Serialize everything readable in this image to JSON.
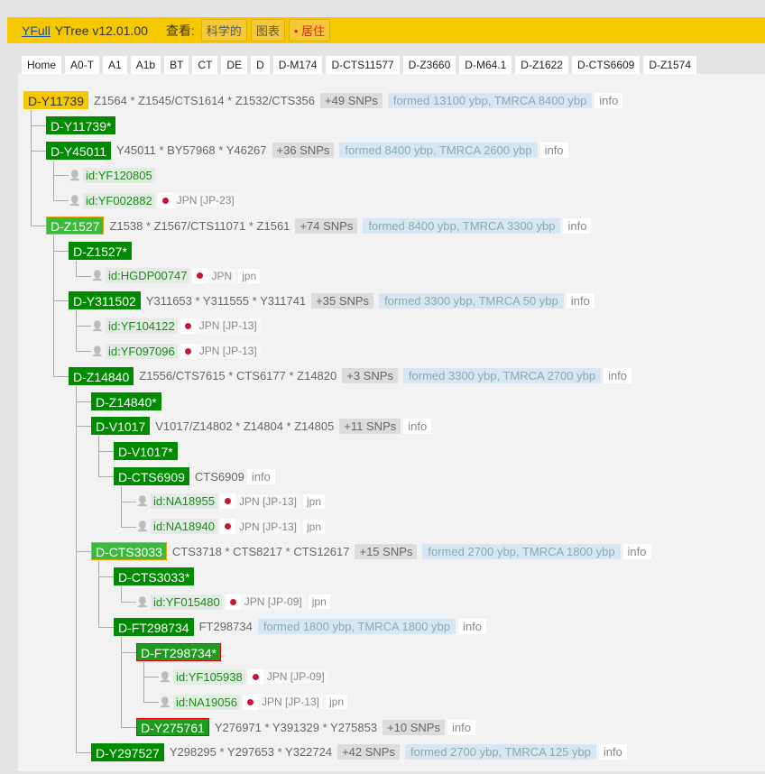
{
  "header": {
    "brand": "YFull",
    "title": "YTree v12.01.00",
    "view_label": "查看:",
    "views": [
      "科学的",
      "图表",
      "• 居住"
    ]
  },
  "tabs": [
    "Home",
    "A0-T",
    "A1",
    "A1b",
    "BT",
    "CT",
    "DE",
    "D",
    "D-M174",
    "D-CTS11577",
    "D-Z3660",
    "D-M64.1",
    "D-Z1622",
    "D-CTS6609",
    "D-Z1574"
  ],
  "colors": {
    "header": "#f5c800",
    "clade": "#008a00",
    "sample": "#1a8a1a"
  },
  "tree": [
    {
      "level": 0,
      "type": "clade",
      "name": "D-Y11739",
      "style": "root",
      "snps": "Z1564 * Z1545/CTS1614 * Z1532/CTS356",
      "count": "+49 SNPs",
      "formed": "formed 13100 ybp, TMRCA 8400 ybp",
      "info": "info"
    },
    {
      "level": 1,
      "type": "clade",
      "name": "D-Y11739*"
    },
    {
      "level": 1,
      "type": "clade",
      "name": "D-Y45011",
      "snps": "Y45011 * BY57968 * Y46267",
      "count": "+36 SNPs",
      "formed": "formed 8400 ybp, TMRCA 2600 ybp",
      "info": "info"
    },
    {
      "level": 2,
      "type": "sample",
      "id": "id:YF120805"
    },
    {
      "level": 2,
      "type": "sample",
      "id": "id:YF002882",
      "flag": "japan-flag",
      "country": "JPN [JP-23]"
    },
    {
      "level": 1,
      "type": "clade",
      "name": "D-Z1527",
      "style": "light",
      "snps": "Z1538 * Z1567/CTS11071 * Z1561",
      "count": "+74 SNPs",
      "formed": "formed 8400 ybp, TMRCA 3300 ybp",
      "info": "info"
    },
    {
      "level": 2,
      "type": "clade",
      "name": "D-Z1527*"
    },
    {
      "level": 3,
      "type": "sample",
      "id": "id:HGDP00747",
      "flag": "japan-flag",
      "country": "JPN",
      "lang": "jpn"
    },
    {
      "level": 2,
      "type": "clade",
      "name": "D-Y311502",
      "snps": "Y311653 * Y311555 * Y311741",
      "count": "+35 SNPs",
      "formed": "formed 3300 ybp, TMRCA 50 ybp",
      "info": "info"
    },
    {
      "level": 3,
      "type": "sample",
      "id": "id:YF104122",
      "flag": "japan-flag",
      "country": "JPN [JP-13]"
    },
    {
      "level": 3,
      "type": "sample",
      "id": "id:YF097096",
      "flag": "japan-flag",
      "country": "JPN [JP-13]"
    },
    {
      "level": 2,
      "type": "clade",
      "name": "D-Z14840",
      "snps": "Z1556/CTS7615 * CTS6177 * Z14820",
      "count": "+3 SNPs",
      "formed": "formed 3300 ybp, TMRCA 2700 ybp",
      "info": "info"
    },
    {
      "level": 3,
      "type": "clade",
      "name": "D-Z14840*"
    },
    {
      "level": 3,
      "type": "clade",
      "name": "D-V1017",
      "snps": "V1017/Z14802 * Z14804 * Z14805",
      "count": "+11 SNPs",
      "info": "info"
    },
    {
      "level": 4,
      "type": "clade",
      "name": "D-V1017*"
    },
    {
      "level": 4,
      "type": "clade",
      "name": "D-CTS6909",
      "snps": "CTS6909",
      "info": "info"
    },
    {
      "level": 5,
      "type": "sample",
      "id": "id:NA18955",
      "flag": "japan-flag",
      "country": "JPN [JP-13]",
      "lang": "jpn"
    },
    {
      "level": 5,
      "type": "sample",
      "id": "id:NA18940",
      "flag": "japan-flag",
      "country": "JPN [JP-13]",
      "lang": "jpn"
    },
    {
      "level": 3,
      "type": "clade",
      "name": "D-CTS3033",
      "style": "light",
      "snps": "CTS3718 * CTS8217 * CTS12617",
      "count": "+15 SNPs",
      "formed": "formed 2700 ybp, TMRCA 1800 ybp",
      "info": "info"
    },
    {
      "level": 4,
      "type": "clade",
      "name": "D-CTS3033*"
    },
    {
      "level": 5,
      "type": "sample",
      "id": "id:YF015480",
      "flag": "japan-flag",
      "country": "JPN [JP-09]",
      "lang": "jpn"
    },
    {
      "level": 4,
      "type": "clade",
      "name": "D-FT298734",
      "snps": "FT298734",
      "formed": "formed 1800 ybp, TMRCA 1800 ybp",
      "info": "info"
    },
    {
      "level": 5,
      "type": "clade",
      "name": "D-FT298734*",
      "style": "red"
    },
    {
      "level": 6,
      "type": "sample",
      "id": "id:YF105938",
      "flag": "japan-flag",
      "country": "JPN [JP-09]"
    },
    {
      "level": 6,
      "type": "sample",
      "id": "id:NA19056",
      "flag": "japan-flag",
      "country": "JPN [JP-13]",
      "lang": "jpn"
    },
    {
      "level": 5,
      "type": "clade",
      "name": "D-Y275761",
      "style": "red",
      "snps": "Y276971 * Y391329 * Y275853",
      "count": "+10 SNPs",
      "info": "info"
    },
    {
      "level": 3,
      "type": "clade",
      "name": "D-Y297527",
      "snps": "Y298295 * Y297653 * Y322724",
      "count": "+42 SNPs",
      "formed": "formed 2700 ybp, TMRCA 125 ybp",
      "info": "info"
    }
  ]
}
